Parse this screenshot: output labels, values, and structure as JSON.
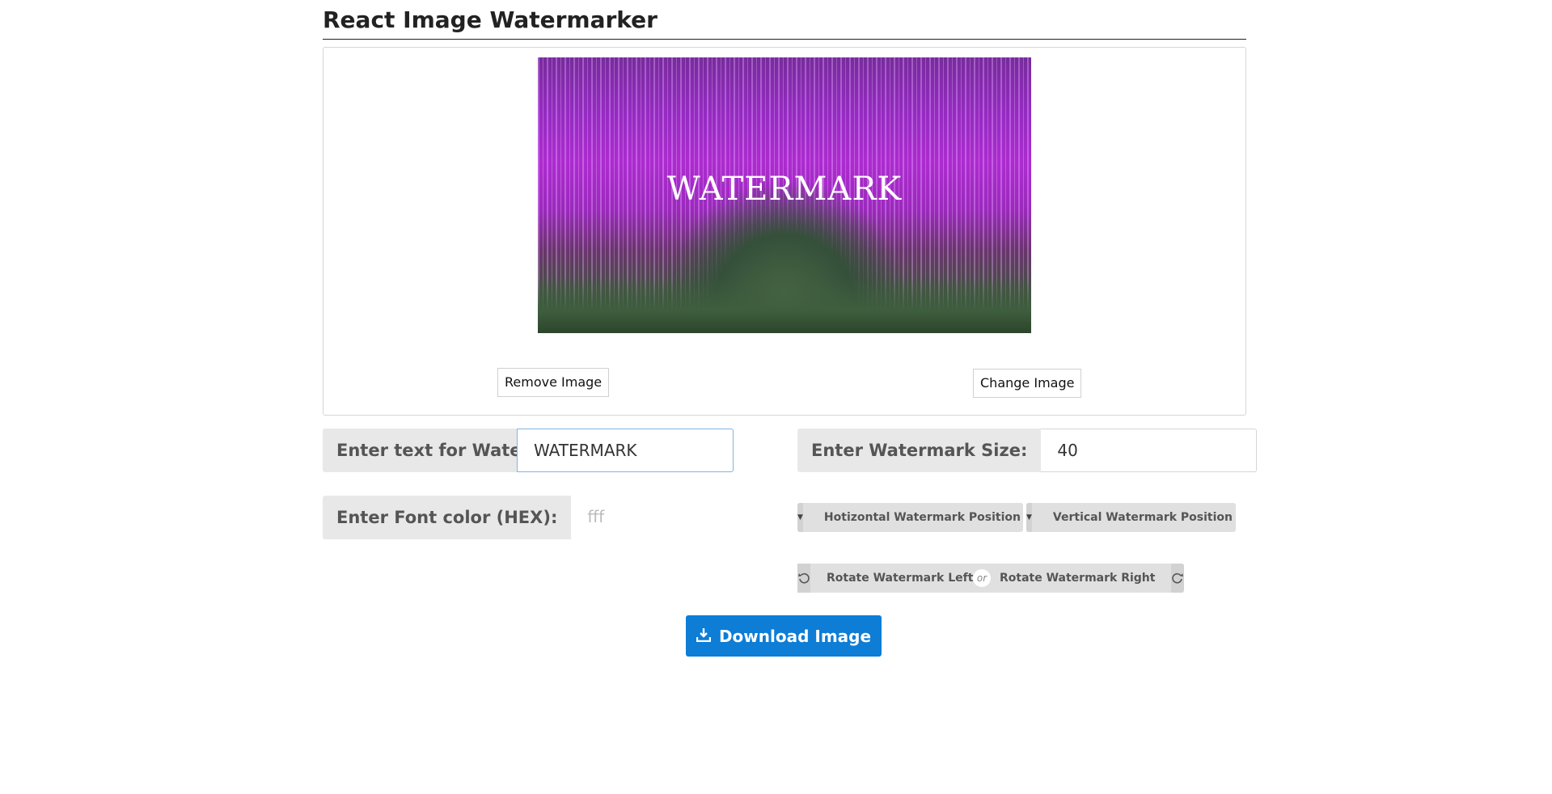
{
  "app": {
    "title": "React Image Watermarker"
  },
  "preview": {
    "watermark_text": "WATERMARK",
    "remove_label": "Remove Image",
    "change_label": "Change Image"
  },
  "form": {
    "text_label": "Enter text for Watermark:",
    "text_value": "WATERMARK",
    "size_label": "Enter Watermark Size:",
    "size_value": "40",
    "color_label": "Enter Font color (HEX):",
    "color_placeholder": "fff"
  },
  "controls": {
    "horizontal_label": "Hotizontal Watermark Position",
    "vertical_label": "Vertical Watermark Position",
    "rotate_left_label": "Rotate Watermark Left",
    "or_label": "or",
    "rotate_right_label": "Rotate Watermark Right"
  },
  "download": {
    "label": "Download Image"
  },
  "colors": {
    "primary": "#0d7dd6",
    "label_bg": "#e8e8e8",
    "button_bg": "#e0e0e0"
  },
  "icons": {
    "caret": "caret-down-icon",
    "rotate_left": "rotate-left-icon",
    "rotate_right": "rotate-right-icon",
    "download": "download-icon"
  }
}
